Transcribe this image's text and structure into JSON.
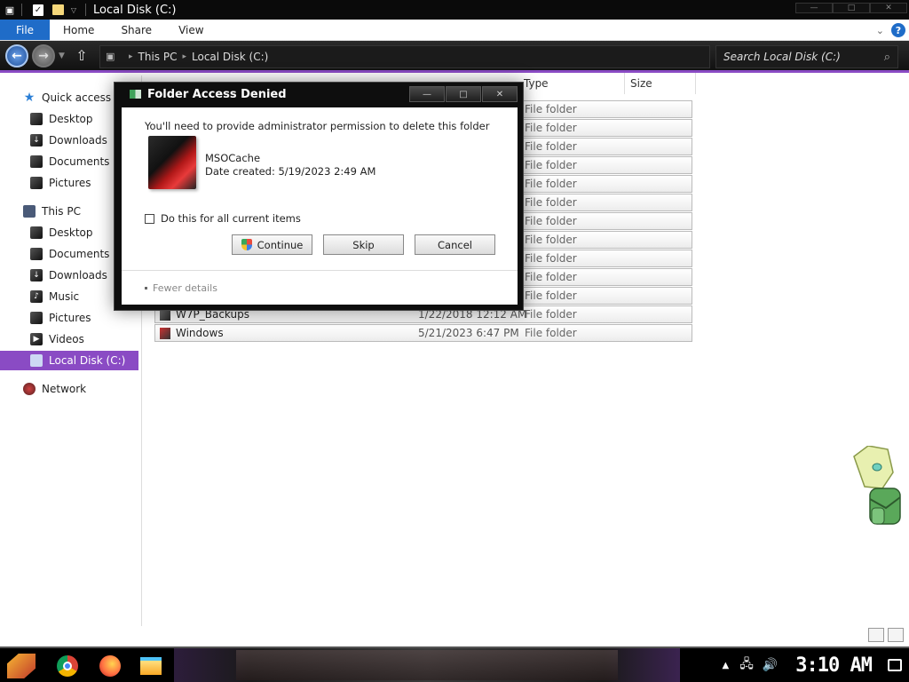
{
  "window": {
    "title": "Local Disk (C:)",
    "controls": {
      "minimize": "—",
      "maximize": "□",
      "close": "✕"
    }
  },
  "ribbon": {
    "tabs": [
      "File",
      "Home",
      "Share",
      "View"
    ]
  },
  "address": {
    "crumbs": [
      "This PC",
      "Local Disk (C:)"
    ],
    "search_placeholder": "Search Local Disk (C:)"
  },
  "sidebar": {
    "items": [
      {
        "label": "Quick access",
        "icon": "star-icon"
      },
      {
        "label": "Desktop",
        "icon": "desktop-icon"
      },
      {
        "label": "Downloads",
        "icon": "downloads-icon"
      },
      {
        "label": "Documents",
        "icon": "documents-icon"
      },
      {
        "label": "Pictures",
        "icon": "pictures-icon"
      },
      {
        "label": "This PC",
        "icon": "computer-icon"
      },
      {
        "label": "Desktop",
        "icon": "desktop-icon"
      },
      {
        "label": "Documents",
        "icon": "documents-icon"
      },
      {
        "label": "Downloads",
        "icon": "downloads-icon"
      },
      {
        "label": "Music",
        "icon": "music-icon"
      },
      {
        "label": "Pictures",
        "icon": "pictures-icon"
      },
      {
        "label": "Videos",
        "icon": "videos-icon"
      },
      {
        "label": "Local Disk (C:)",
        "icon": "drive-icon",
        "selected": true
      },
      {
        "label": "Network",
        "icon": "network-icon"
      }
    ]
  },
  "columns": {
    "type": "Type",
    "size": "Size"
  },
  "files": [
    {
      "type": "File folder"
    },
    {
      "type": "File folder"
    },
    {
      "type": "File folder"
    },
    {
      "type": "File folder"
    },
    {
      "type": "File folder"
    },
    {
      "type": "File folder"
    },
    {
      "type": "File folder"
    },
    {
      "type": "File folder"
    },
    {
      "type": "File folder"
    },
    {
      "type": "File folder"
    },
    {
      "type": "File folder"
    },
    {
      "name": "W7P_Backups",
      "date": "1/22/2018 12:12 AM",
      "type": "File folder"
    },
    {
      "name": "Windows",
      "date": "5/21/2023 6:47 PM",
      "type": "File folder"
    }
  ],
  "dialog": {
    "title": "Folder Access Denied",
    "message": "You'll need to provide administrator permission to delete this folder",
    "folder_name": "MSOCache",
    "folder_date": "Date created: 5/19/2023 2:49 AM",
    "checkbox_label": "Do this for all current items",
    "buttons": {
      "continue": "Continue",
      "skip": "Skip",
      "cancel": "Cancel"
    },
    "fewer_details": "Fewer details",
    "controls": {
      "minimize": "—",
      "maximize": "□",
      "close": "✕"
    }
  },
  "taskbar": {
    "apps": [
      "start-button",
      "chrome-icon",
      "firefox-icon",
      "file-explorer-icon"
    ],
    "clock": "3:10 AM"
  },
  "colors": {
    "accent": "#8a4bc4",
    "file_tab": "#1f6cc8",
    "title_bar": "#0a0a0a"
  }
}
